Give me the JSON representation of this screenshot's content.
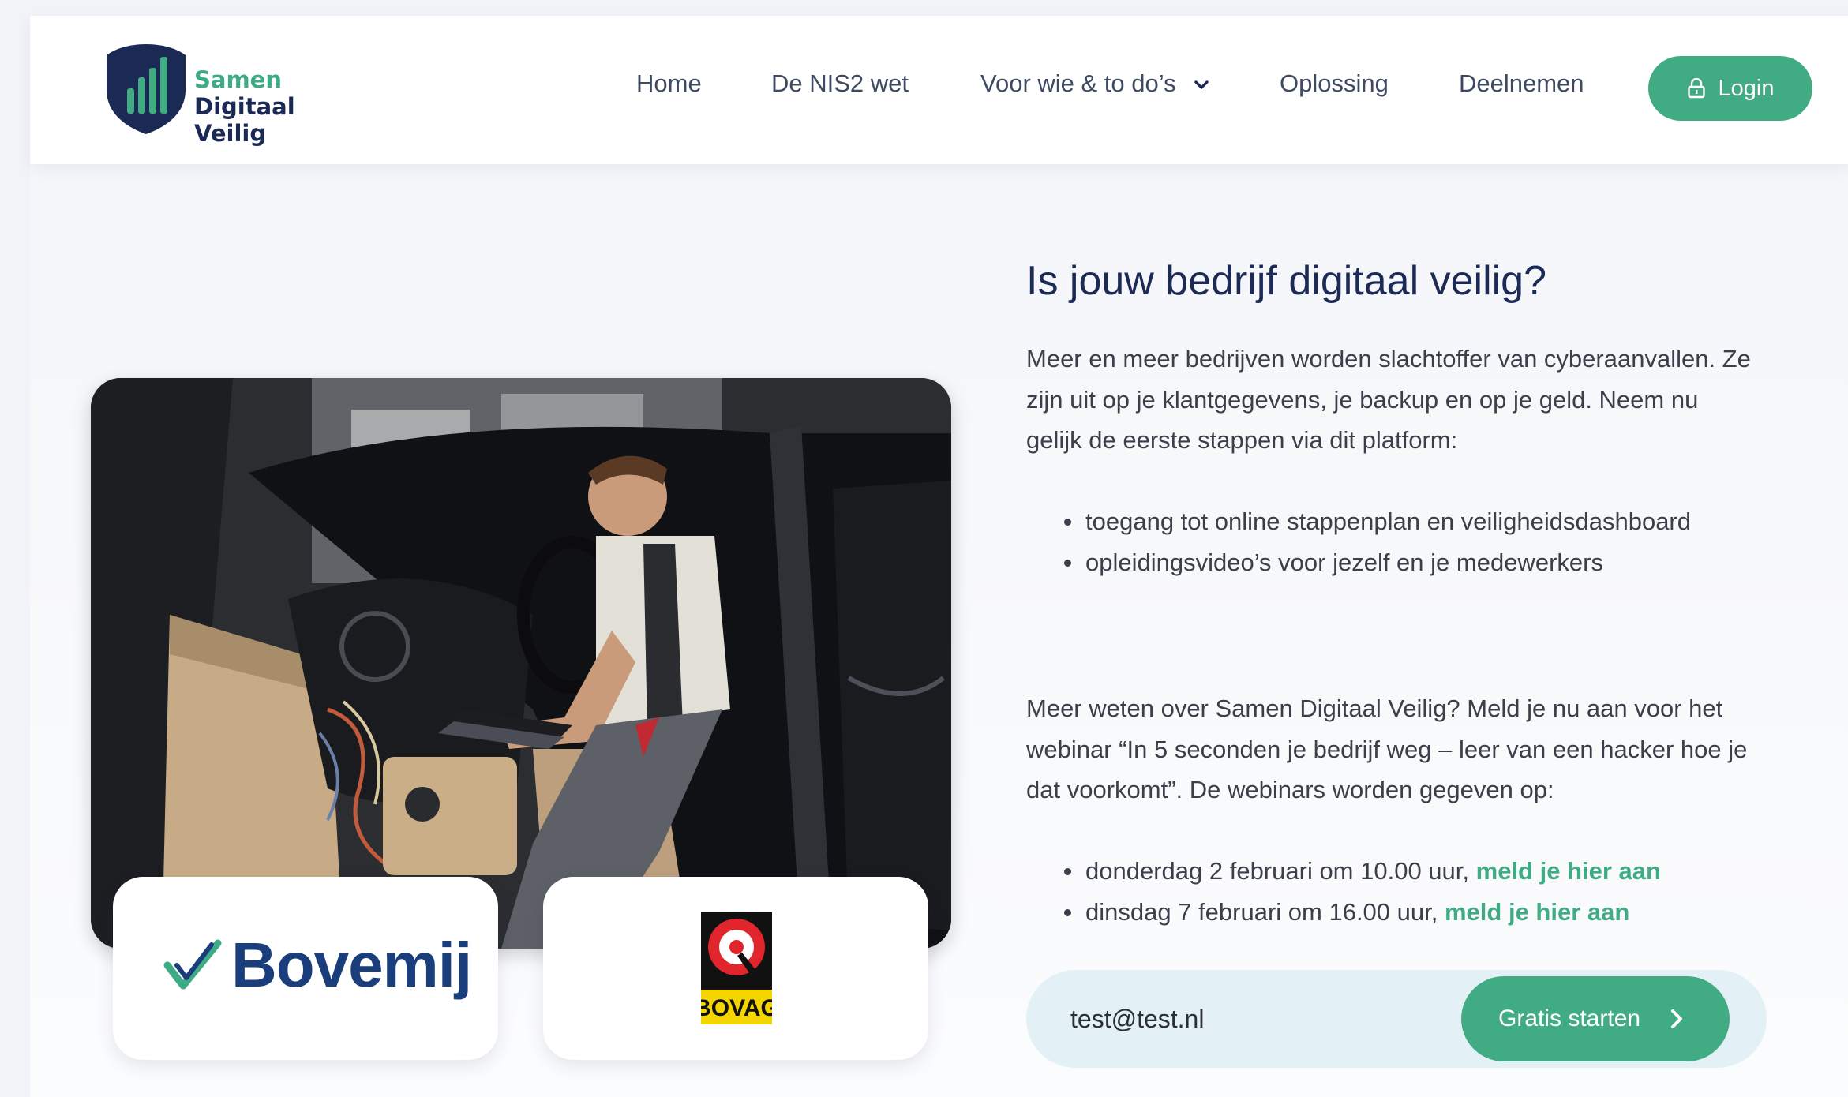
{
  "brand": {
    "line1": "Samen",
    "line2": "Digitaal",
    "line3": "Veilig",
    "green": "#41ac84",
    "navy": "#1b2a55"
  },
  "nav": {
    "items": [
      {
        "label": "Home"
      },
      {
        "label": "De NIS2 wet"
      },
      {
        "label": "Voor wie & to do’s",
        "has_dropdown": true
      },
      {
        "label": "Oplossing"
      },
      {
        "label": "Deelnemen"
      }
    ],
    "login_label": "Login",
    "login_icon": "lock-icon"
  },
  "hero": {
    "title": "Is jouw bedrijf digitaal veilig?",
    "intro": "Meer en meer bedrijven worden slachtoffer van cyberaanvallen. Ze zijn uit op je klantgegevens, je backup en op je geld. Neem nu gelijk de eerste stappen via dit platform:",
    "features": [
      "toegang tot online stappenplan en veiligheidsdashboard",
      "opleidingsvideo’s voor jezelf en je medewerkers"
    ],
    "webinar_text": "Meer weten over Samen Digitaal Veilig? Meld je nu aan voor het webinar “In 5 seconden je bedrijf weg – leer van een hacker hoe je dat voorkomt”. De webinars worden gegeven op:",
    "sessions": [
      {
        "text": "donderdag 2 februari om 10.00 uur,",
        "link": "meld je hier aan"
      },
      {
        "text": "dinsdag 7 februari om 16.00 uur,",
        "link": "meld je hier aan"
      }
    ]
  },
  "partners": {
    "bovemij": "Bovemij",
    "bovag": "BOVAG"
  },
  "signup": {
    "email_value": "test@test.nl",
    "button_label": "Gratis starten"
  }
}
